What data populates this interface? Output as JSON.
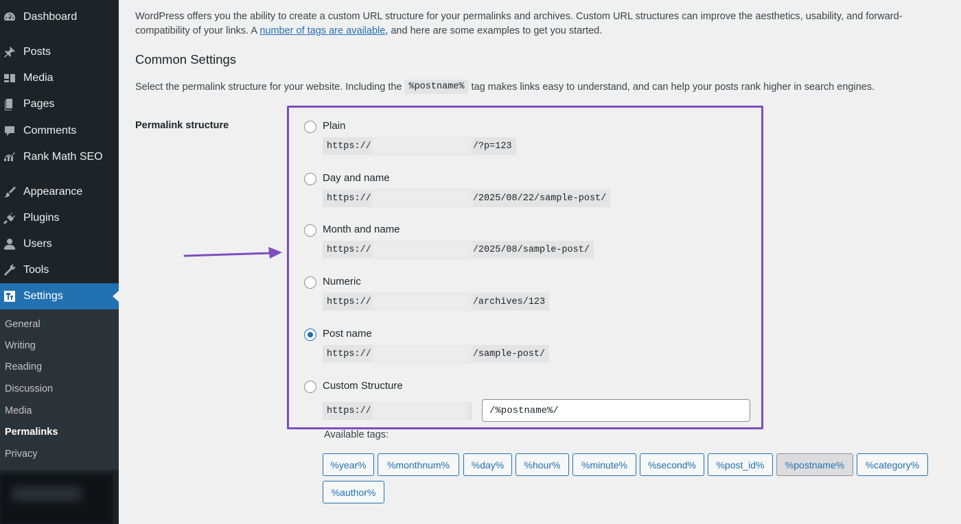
{
  "sidebar": {
    "items": [
      {
        "label": "Dashboard",
        "icon": "dashboard-icon"
      },
      {
        "label": "Posts",
        "icon": "pin-icon"
      },
      {
        "label": "Media",
        "icon": "media-icon"
      },
      {
        "label": "Pages",
        "icon": "pages-icon"
      },
      {
        "label": "Comments",
        "icon": "comment-icon"
      },
      {
        "label": "Rank Math SEO",
        "icon": "rank-math-icon"
      },
      {
        "label": "Appearance",
        "icon": "brush-icon"
      },
      {
        "label": "Plugins",
        "icon": "plugin-icon"
      },
      {
        "label": "Users",
        "icon": "user-icon"
      },
      {
        "label": "Tools",
        "icon": "wrench-icon"
      },
      {
        "label": "Settings",
        "icon": "settings-icon",
        "active": true
      }
    ],
    "submenu": [
      "General",
      "Writing",
      "Reading",
      "Discussion",
      "Media",
      "Permalinks",
      "Privacy"
    ],
    "current_submenu": "Permalinks"
  },
  "intro": {
    "before_link": "WordPress offers you the ability to create a custom URL structure for your permalinks and archives. Custom URL structures can improve the aesthetics, usability, and forward-compatibility of your links. A ",
    "link": "number of tags are available",
    "after_link": ", and here are some examples to get you started."
  },
  "common": {
    "title": "Common Settings",
    "desc_before": "Select the permalink structure for your website. Including the",
    "desc_code": "%postname%",
    "desc_after": "tag makes links easy to understand, and can help your posts rank higher in search engines."
  },
  "permalink_label": "Permalink structure",
  "options": [
    {
      "label": "Plain",
      "prefix": "https://",
      "suffix": "/?p=123",
      "checked": false
    },
    {
      "label": "Day and name",
      "prefix": "https://",
      "suffix": "/2025/08/22/sample-post/",
      "checked": false
    },
    {
      "label": "Month and name",
      "prefix": "https://",
      "suffix": "/2025/08/sample-post/",
      "checked": false
    },
    {
      "label": "Numeric",
      "prefix": "https://",
      "suffix": "/archives/123",
      "checked": false
    },
    {
      "label": "Post name",
      "prefix": "https://",
      "suffix": "/sample-post/",
      "checked": true
    },
    {
      "label": "Custom Structure",
      "prefix": "https://",
      "suffix": "",
      "checked": false
    }
  ],
  "custom_value": "/%postname%/",
  "available_tags_label": "Available tags:",
  "tags": [
    "%year%",
    "%monthnum%",
    "%day%",
    "%hour%",
    "%minute%",
    "%second%",
    "%post_id%",
    "%postname%",
    "%category%",
    "%author%"
  ],
  "active_tag": "%postname%",
  "colors": {
    "sidebar_bg": "#1d2327",
    "accent": "#2271b1",
    "highlight_border": "#7c4dbe",
    "arrow": "#7c4dbe"
  }
}
